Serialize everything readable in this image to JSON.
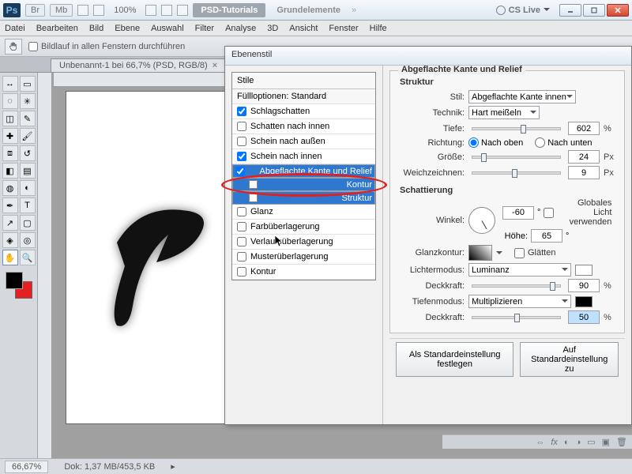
{
  "titlebar": {
    "app_badge": "Ps",
    "chips": [
      "Br",
      "Mb"
    ],
    "zoom": "100%",
    "breadcrumb1": "PSD-Tutorials",
    "breadcrumb2": "Grundelemente",
    "cslive": "CS Live"
  },
  "menubar": [
    "Datei",
    "Bearbeiten",
    "Bild",
    "Ebene",
    "Auswahl",
    "Filter",
    "Analyse",
    "3D",
    "Ansicht",
    "Fenster",
    "Hilfe"
  ],
  "optbar": {
    "scroll_all_label": "Bildlauf in allen Fenstern durchführen"
  },
  "doctab": {
    "label": "Unbenannt-1 bei 66,7% (PSD, RGB/8)"
  },
  "status": {
    "zoom": "66,67%",
    "docinfo": "Dok: 1,37 MB/453,5 KB"
  },
  "dialog": {
    "title": "Ebenenstil",
    "styles_header": "Stile",
    "fill_section": "Füllloptionen: Standard",
    "items": [
      {
        "label": "Schlagschatten",
        "checked": true
      },
      {
        "label": "Schatten nach innen",
        "checked": false
      },
      {
        "label": "Schein nach außen",
        "checked": false
      },
      {
        "label": "Schein nach innen",
        "checked": true
      },
      {
        "label": "Abgeflachte Kante und Relief",
        "checked": true,
        "selected": true
      },
      {
        "label": "Kontur",
        "sub": true,
        "sq": true,
        "selected": true
      },
      {
        "label": "Struktur",
        "sub": true,
        "sq": true,
        "selected": true
      },
      {
        "label": "Glanz",
        "checked": false
      },
      {
        "label": "Farbüberlagerung",
        "checked": false
      },
      {
        "label": "Verlaufsüberlagerung",
        "checked": false
      },
      {
        "label": "Musterüberlagerung",
        "checked": false
      },
      {
        "label": "Kontur",
        "checked": false
      }
    ],
    "right": {
      "group1_title": "Abgeflachte Kante und Relief",
      "struct_title": "Struktur",
      "stil_label": "Stil:",
      "stil_value": "Abgeflachte Kante innen",
      "technik_label": "Technik:",
      "technik_value": "Hart meißeln",
      "tiefe_label": "Tiefe:",
      "tiefe_value": "602",
      "richtung_label": "Richtung:",
      "richtung_up": "Nach oben",
      "richtung_down": "Nach unten",
      "groesse_label": "Größe:",
      "groesse_value": "24",
      "weich_label": "Weichzeichnen:",
      "weich_value": "9",
      "shade_title": "Schattierung",
      "winkel_label": "Winkel:",
      "winkel_value": "-60",
      "global_light": "Globales Licht verwenden",
      "hoehe_label": "Höhe:",
      "hoehe_value": "65",
      "glanzk_label": "Glanzkontur:",
      "glaetten": "Glätten",
      "lichter_label": "Lichtermodus:",
      "lichter_value": "Luminanz",
      "deck_label": "Deckkraft:",
      "deck1_value": "90",
      "tiefen_label": "Tiefenmodus:",
      "tiefen_value": "Multiplizieren",
      "deck2_value": "50",
      "btn_default": "Als Standardeinstellung festlegen",
      "btn_reset": "Auf Standardeinstellung zu"
    }
  }
}
